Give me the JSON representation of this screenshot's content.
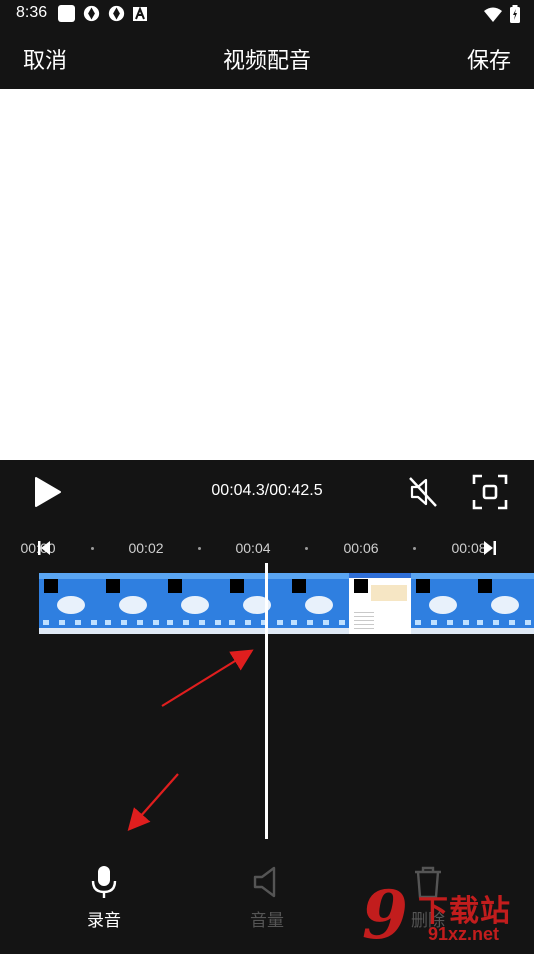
{
  "status_bar": {
    "time": "8:36",
    "battery_label": "battery-charging-icon",
    "icons_left": [
      "square-notification-icon",
      "aperture-icon",
      "aperture-icon",
      "letter-a-icon"
    ],
    "icons_right": [
      "wifi-icon",
      "battery-icon"
    ]
  },
  "header": {
    "cancel_label": "取消",
    "title": "视频配音",
    "save_label": "保存"
  },
  "player": {
    "time_display": "00:04.3/00:42.5",
    "play_icon": "play-icon",
    "mute_icon": "mute-icon",
    "fullscreen_icon": "fullscreen-icon"
  },
  "ruler": {
    "ticks": [
      "00:00",
      "00:02",
      "00:04",
      "00:06",
      "00:08"
    ],
    "start_marker": "start-marker-icon",
    "end_marker": "end-marker-icon"
  },
  "timeline": {
    "frame_count": 8,
    "playhead_seconds": 4.3,
    "duration_seconds": 42.5
  },
  "tools": {
    "record_label": "录音",
    "volume_label": "音量",
    "delete_label": "删除"
  },
  "watermark": {
    "text": "下载站",
    "domain": "91xz.net",
    "nine": "9"
  },
  "colors": {
    "background": "#141414",
    "annotation_arrow": "#e01e1e",
    "watermark": "#c21d1d",
    "timeline_frame": "#2f7fe0",
    "disabled_tool": "#555555"
  }
}
